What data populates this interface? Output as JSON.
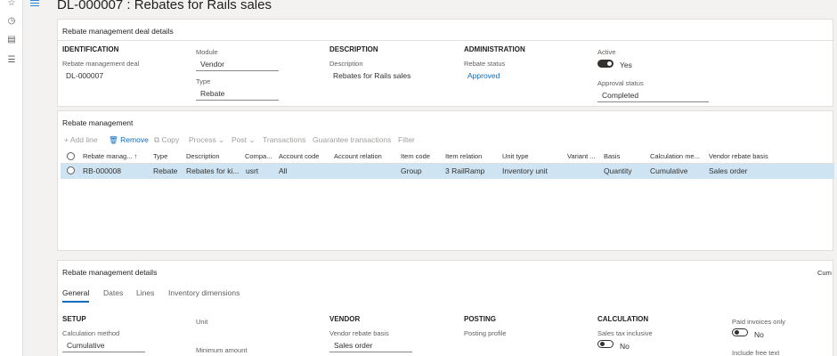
{
  "page": {
    "title": "DL-000007 : Rebates for Rails sales"
  },
  "deal_details": {
    "heading": "Rebate management deal details",
    "identification": {
      "heading": "IDENTIFICATION",
      "deal_label": "Rebate management deal",
      "deal_value": "DL-000007"
    },
    "module": {
      "label": "Module",
      "value": "Vendor"
    },
    "type": {
      "label": "Type",
      "value": "Rebate"
    },
    "description": {
      "heading": "DESCRIPTION",
      "label": "Description",
      "value": "Rebates for Rails sales"
    },
    "administration": {
      "heading": "ADMINISTRATION",
      "status_label": "Rebate status",
      "status_value": "Approved"
    },
    "active": {
      "label": "Active",
      "value": "Yes"
    },
    "approval": {
      "label": "Approval status",
      "value": "Completed"
    }
  },
  "rebate_management": {
    "heading": "Rebate management",
    "toolbar": {
      "add_line": "+ Add line",
      "remove": "Remove",
      "copy": "Copy",
      "process": "Process",
      "post": "Post",
      "transactions": "Transactions",
      "guarantee": "Guarantee transactions",
      "filter": "Filter"
    },
    "columns": [
      "Rebate manag...",
      "Type",
      "Description",
      "Compa...",
      "Account code",
      "Account relation",
      "Item code",
      "Item relation",
      "Unit type",
      "Variant ...",
      "Basis",
      "Calculation me...",
      "Vendor rebate basis"
    ],
    "sort_indicator": "↑",
    "rows": [
      [
        "RB-000008",
        "Rebate",
        "Rebates for ki...",
        "usrt",
        "All",
        "",
        "Group",
        "3 RailRamp",
        "Inventory unit",
        "",
        "Quantity",
        "Cumulative",
        "Sales order"
      ]
    ]
  },
  "details": {
    "heading": "Rebate management details",
    "right_clip": "Cum",
    "tabs": [
      "General",
      "Dates",
      "Lines",
      "Inventory dimensions"
    ],
    "setup": {
      "heading": "SETUP",
      "calc_label": "Calculation method",
      "calc_value": "Cumulative"
    },
    "unit": {
      "label": "Unit",
      "min_label": "Minimum amount"
    },
    "vendor": {
      "heading": "VENDOR",
      "basis_label": "Vendor rebate basis",
      "basis_value": "Sales order"
    },
    "posting": {
      "heading": "POSTING",
      "profile_label": "Posting profile"
    },
    "calculation": {
      "heading": "CALCULATION",
      "tax_label": "Sales tax inclusive",
      "tax_value": "No"
    },
    "paid": {
      "label": "Paid invoices only",
      "value": "No"
    },
    "free_text": {
      "label": "Include free text"
    }
  }
}
